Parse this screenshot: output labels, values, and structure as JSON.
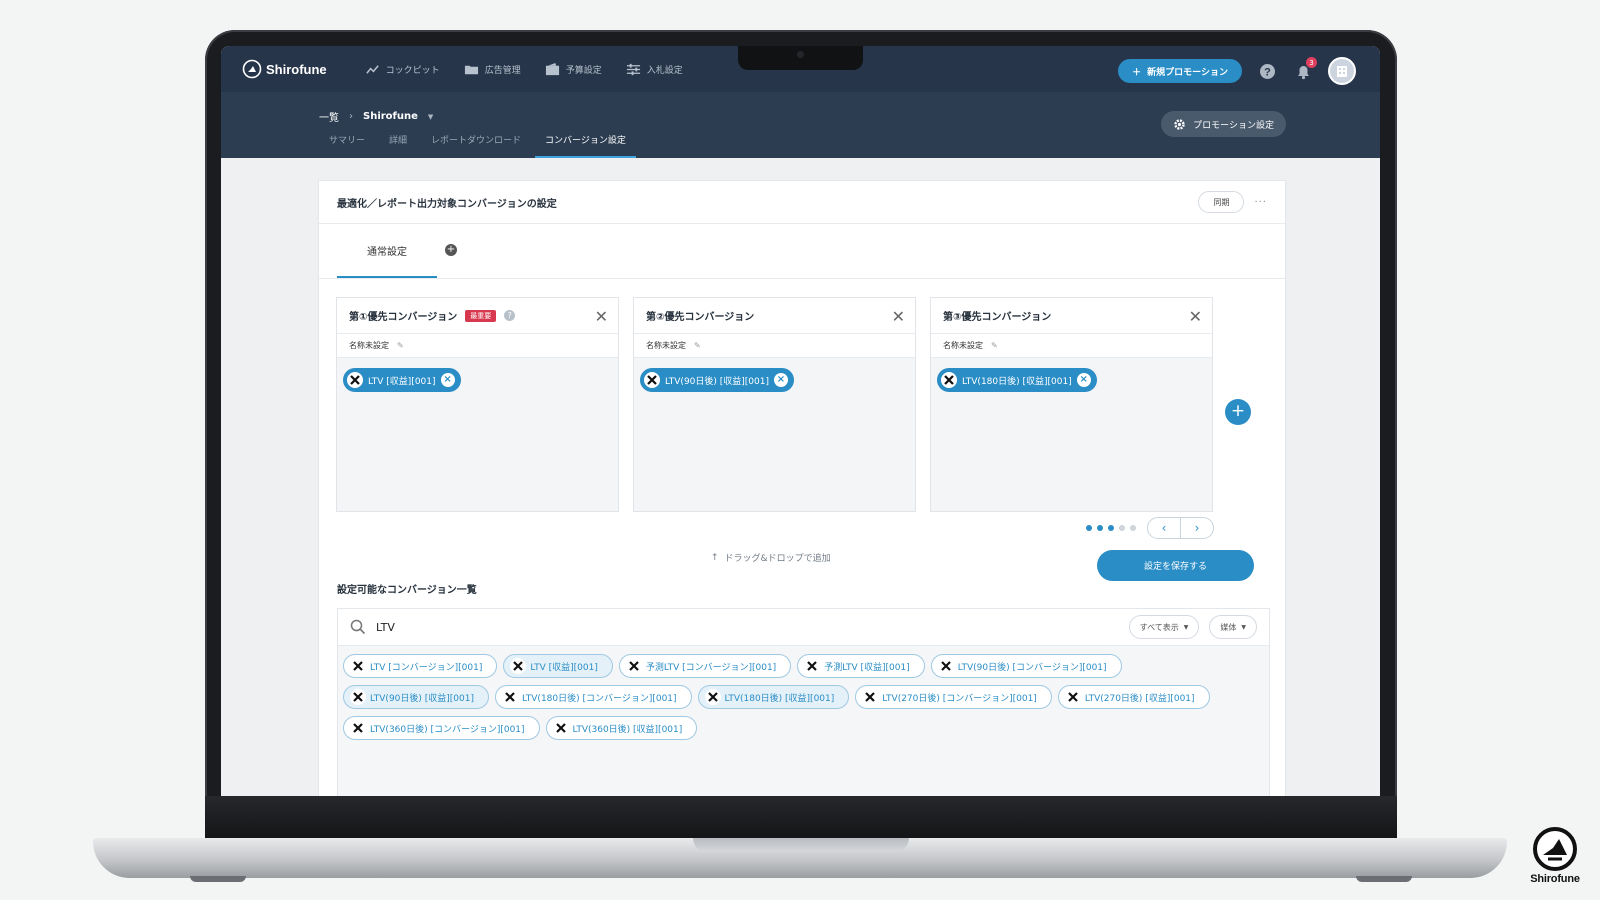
{
  "brand": {
    "name": "Shirofune"
  },
  "nav": [
    {
      "label": "コックピット",
      "icon": "trend-icon"
    },
    {
      "label": "広告管理",
      "icon": "folder-icon"
    },
    {
      "label": "予算設定",
      "icon": "wallet-icon"
    },
    {
      "label": "入札設定",
      "icon": "sliders-icon"
    }
  ],
  "topbar": {
    "new_promotion": "新規プロモーション",
    "notification_count": "3"
  },
  "breadcrumb": {
    "root": "一覧",
    "project": "Shirofune"
  },
  "tabs": [
    {
      "label": "サマリー",
      "active": false
    },
    {
      "label": "詳細",
      "active": false
    },
    {
      "label": "レポートダウンロード",
      "active": false
    },
    {
      "label": "コンバージョン設定",
      "active": true
    }
  ],
  "promotion_settings": "プロモーション設定",
  "card": {
    "title": "最適化／レポート出力対象コンバージョンの設定",
    "sync": "同期",
    "more": "···",
    "set_tab": "通常設定"
  },
  "priorities": [
    {
      "title": "第①優先コンバージョン",
      "badge": "最重要",
      "name": "名称未設定",
      "chip": "LTV [収益][001]"
    },
    {
      "title": "第②優先コンバージョン",
      "badge": "",
      "name": "名称未設定",
      "chip": "LTV(90日後) [収益][001]"
    },
    {
      "title": "第③優先コンバージョン",
      "badge": "",
      "name": "名称未設定",
      "chip": "LTV(180日後) [収益][001]"
    }
  ],
  "pager": {
    "pages": 5,
    "active_pages": [
      1,
      2,
      3
    ]
  },
  "drag_hint": "ドラッグ&ドロップで追加",
  "save_button": "設定を保存する",
  "list": {
    "title": "設定可能なコンバージョン一覧",
    "search_value": "LTV",
    "filter_all": "すべて表示",
    "filter_media": "媒体",
    "chips": [
      {
        "label": "LTV [コンバージョン][001]",
        "used": false
      },
      {
        "label": "LTV [収益][001]",
        "used": true
      },
      {
        "label": "予測LTV [コンバージョン][001]",
        "used": false
      },
      {
        "label": "予測LTV [収益][001]",
        "used": false
      },
      {
        "label": "LTV(90日後) [コンバージョン][001]",
        "used": false
      },
      {
        "label": "LTV(90日後) [収益][001]",
        "used": true
      },
      {
        "label": "LTV(180日後) [コンバージョン][001]",
        "used": false
      },
      {
        "label": "LTV(180日後) [収益][001]",
        "used": true
      },
      {
        "label": "LTV(270日後) [コンバージョン][001]",
        "used": false
      },
      {
        "label": "LTV(270日後) [収益][001]",
        "used": false
      },
      {
        "label": "LTV(360日後) [コンバージョン][001]",
        "used": false
      },
      {
        "label": "LTV(360日後) [収益][001]",
        "used": false
      }
    ]
  },
  "corner_logo": "Shirofune",
  "colors": {
    "accent": "#2a8dc6",
    "topbar": "#26354a",
    "important": "#d7384f"
  }
}
